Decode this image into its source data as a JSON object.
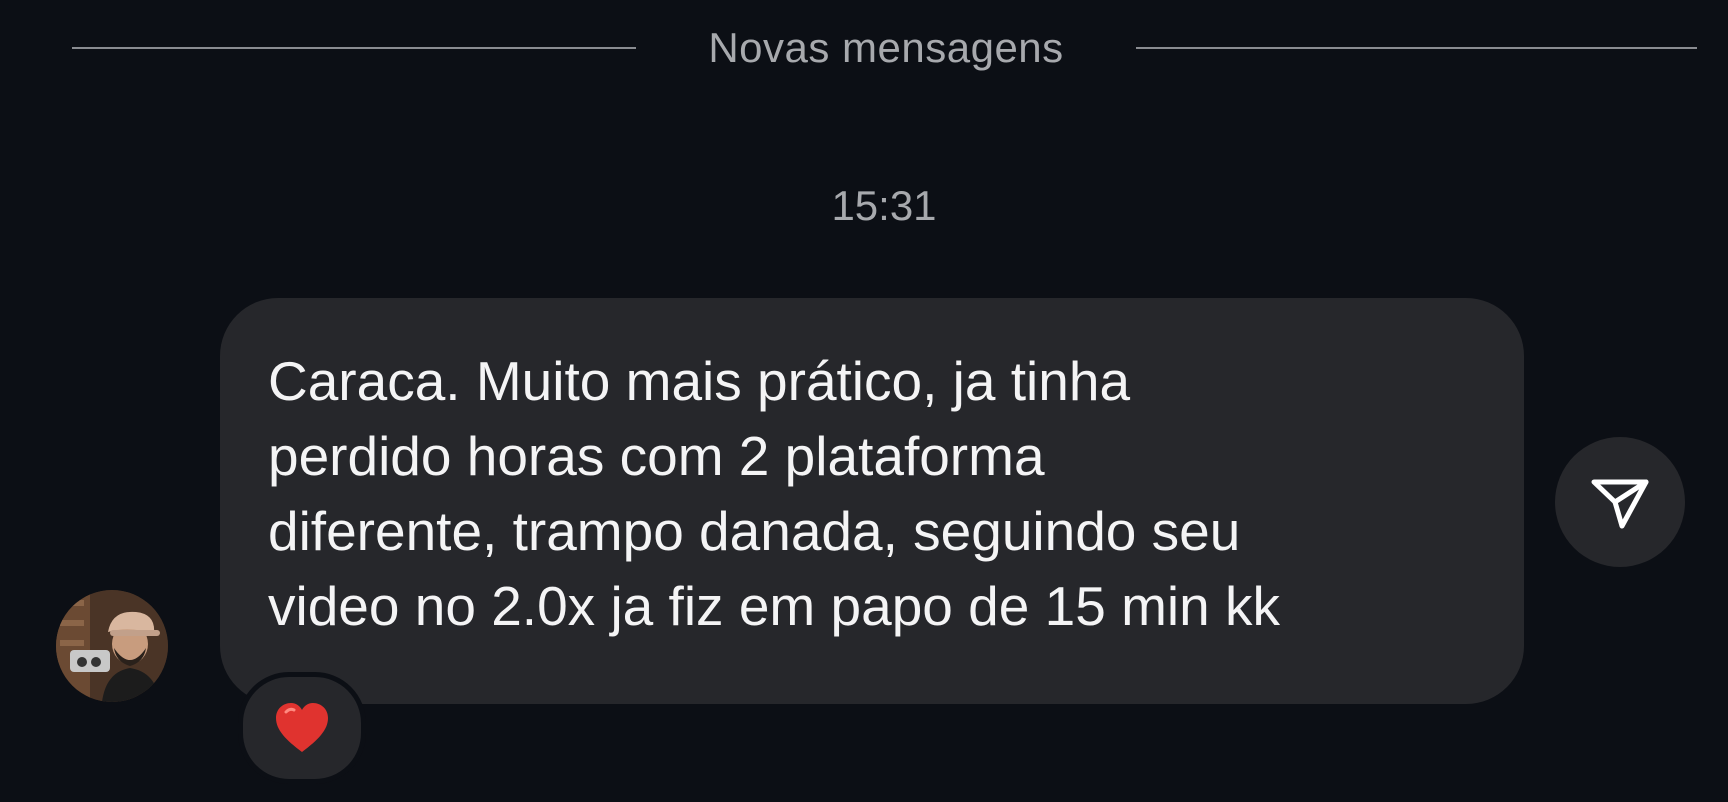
{
  "divider": {
    "label": "Novas mensagens"
  },
  "timestamp": "15:31",
  "message": {
    "lines": [
      "Caraca. Muito mais prático, ja tinha",
      "perdido horas com 2 plataforma",
      "diferente, trampo danada, seguindo seu",
      "video no 2.0x ja fiz em papo de 15 min kk"
    ],
    "reaction_icon": "red-heart",
    "sender_avatar_icon": "avatar-photo"
  },
  "share_icon": "paper-plane-icon",
  "colors": {
    "background": "#0c0f15",
    "bubble": "#26272b",
    "text": "#f4f4f5",
    "muted_text": "#a7a9ad",
    "heart": "#e0332f"
  }
}
